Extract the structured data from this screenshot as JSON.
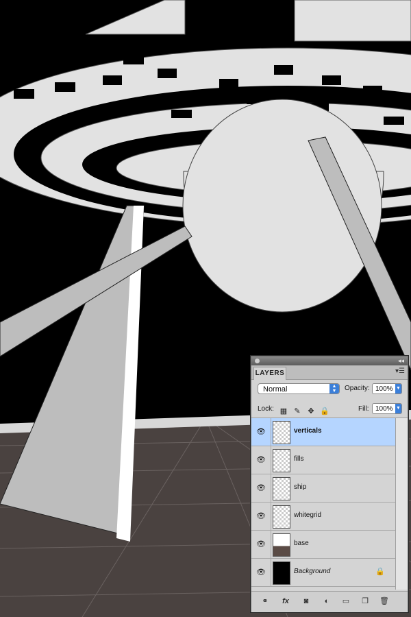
{
  "layers_panel": {
    "tab_label": "LAYERS",
    "blend_mode": "Normal",
    "opacity_label": "Opacity:",
    "opacity_value": "100%",
    "lock_label": "Lock:",
    "fill_label": "Fill:",
    "fill_value": "100%",
    "layers": [
      {
        "name": "verticals",
        "selected": true
      },
      {
        "name": "fills",
        "selected": false
      },
      {
        "name": "ship",
        "selected": false
      },
      {
        "name": "whitegrid",
        "selected": false
      },
      {
        "name": "base",
        "selected": false
      },
      {
        "name": "Background",
        "selected": false,
        "locked": true
      }
    ],
    "footer_icons": [
      "link-layers-icon",
      "fx-icon",
      "mask-icon",
      "adjustment-icon",
      "group-folder-icon",
      "new-layer-icon",
      "trash-icon"
    ]
  },
  "colors": {
    "canvas_black": "#000000",
    "ship_white": "#e4e4e4",
    "ground": "#4a4240",
    "panel_bg": "#d4d4d4",
    "selection": "#b5d5ff",
    "accent_blue": "#3b7fd9"
  }
}
